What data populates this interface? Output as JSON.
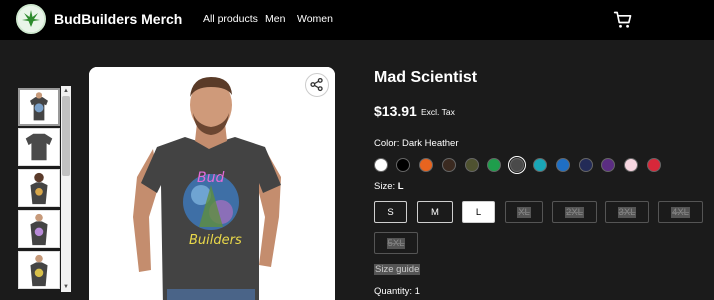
{
  "header": {
    "brand": "BudBuilders Merch",
    "nav": [
      "All products",
      "Men",
      "Women"
    ],
    "cart_icon": "cart-icon",
    "logo_icon": "cannabis-leaf-icon"
  },
  "product": {
    "title": "Mad Scientist",
    "price": "$13.91",
    "tax_note": "Excl. Tax",
    "color_label": "Color:",
    "color_value": "Dark Heather",
    "colors": [
      "#ffffff",
      "#000000",
      "#e8641f",
      "#3b2a20",
      "#4f5230",
      "#1f9e4c",
      "#4a4a4a",
      "#1aa6b7",
      "#1f6fc4",
      "#232b57",
      "#5b2d82",
      "#f7d6e0",
      "#d8283a"
    ],
    "selected_color_index": 6,
    "size_label": "Size:",
    "size_value": "L",
    "sizes": [
      "S",
      "M",
      "L",
      "XL",
      "2XL",
      "3XL",
      "4XL",
      "5XL"
    ],
    "selected_size_index": 2,
    "unavailable_sizes": [
      "XL",
      "2XL",
      "3XL",
      "4XL",
      "5XL"
    ],
    "size_guide": "Size guide",
    "quantity_label": "Quantity:",
    "quantity_value": "1"
  },
  "gallery": {
    "share_icon": "share-icon",
    "thumbnails": 5,
    "selected_thumbnail": 0,
    "print_text": [
      "Bud",
      "Builders"
    ]
  },
  "colors": {
    "background": "#1b1b1b",
    "header": "#000000",
    "shirt": "#434343"
  }
}
